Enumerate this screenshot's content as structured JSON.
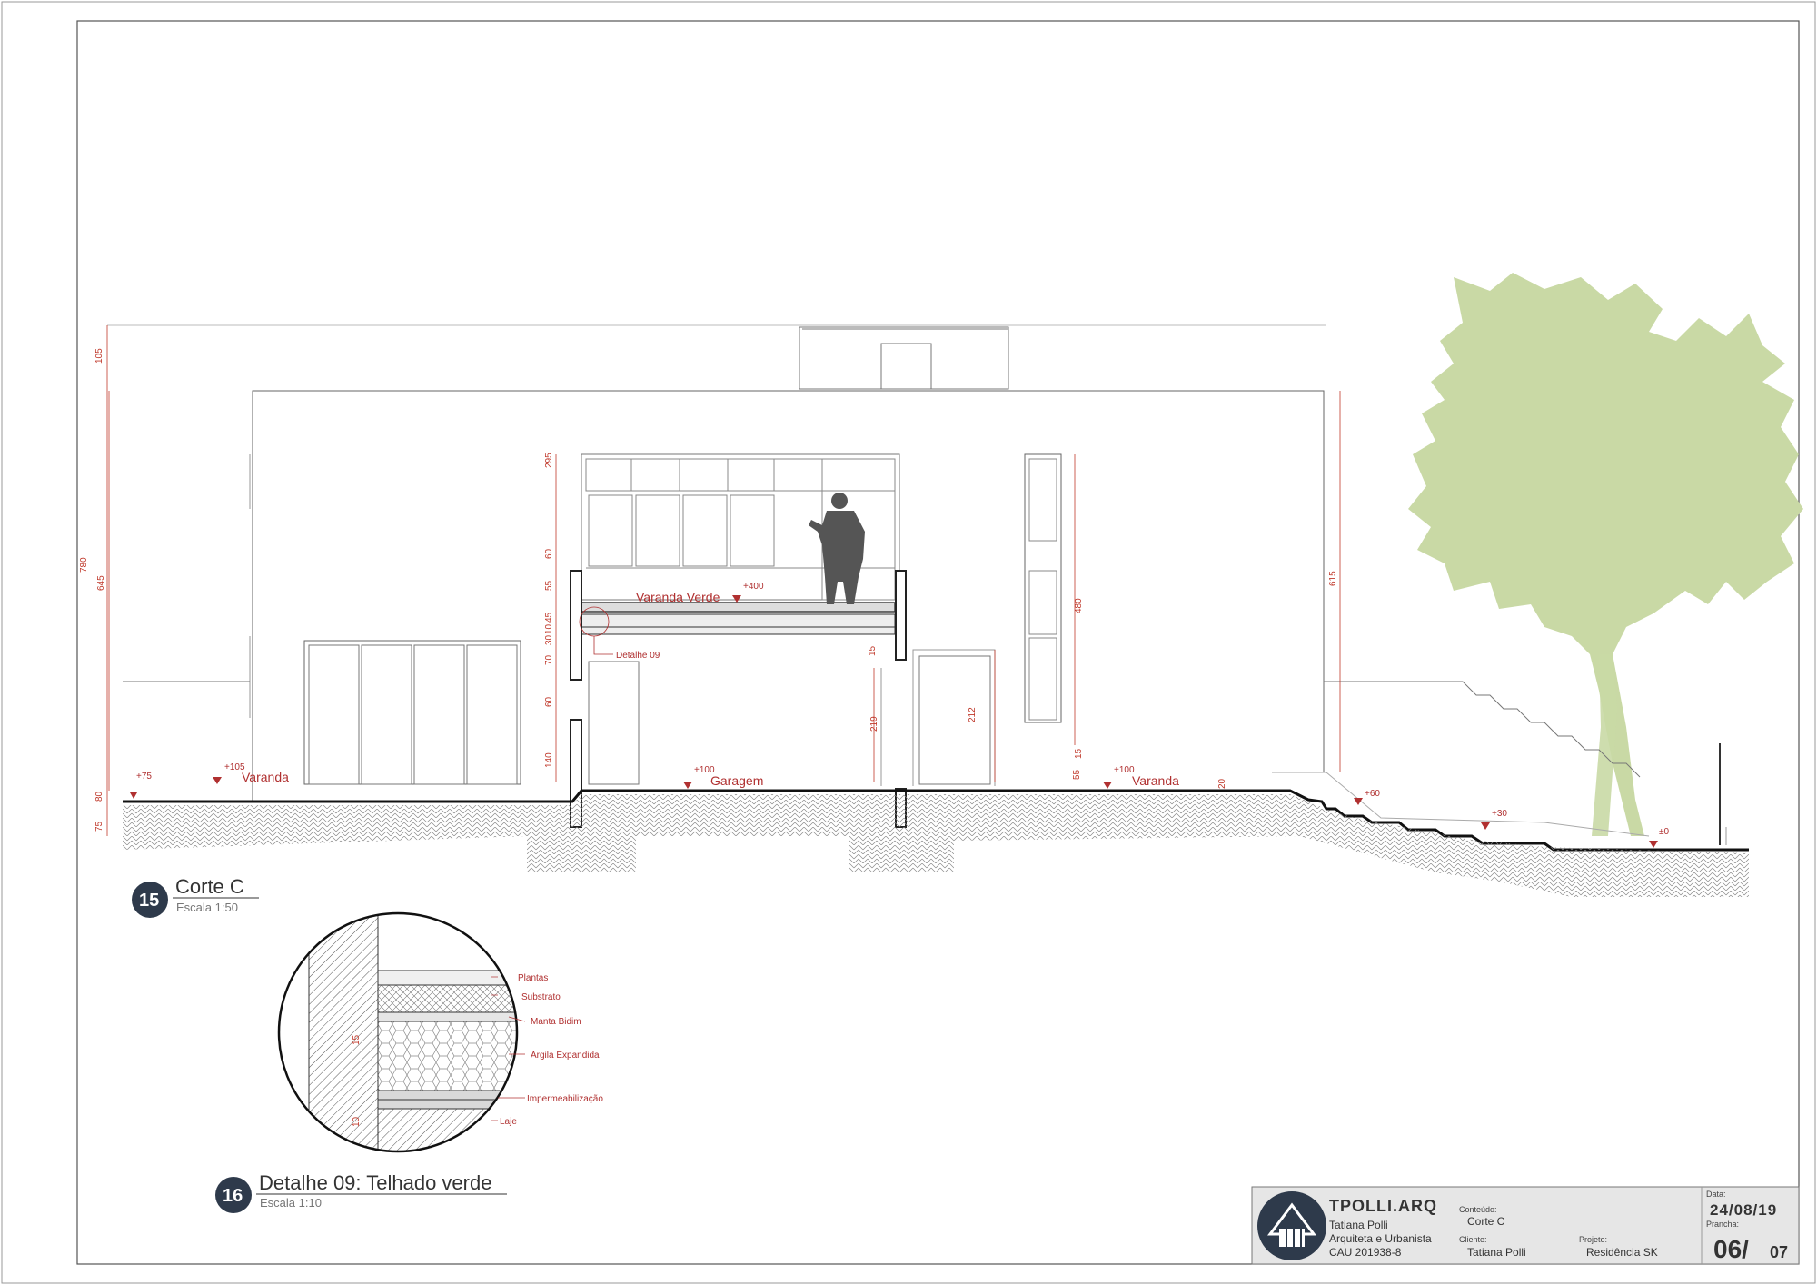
{
  "section": {
    "number": "15",
    "title": "Corte C",
    "scale": "Escala 1:50",
    "rooms": [
      "Varanda",
      "Varanda Verde",
      "Garagem",
      "Varanda"
    ],
    "detail_callout": "Detalhe 09",
    "levels": [
      "+75",
      "+105",
      "+400",
      "+100",
      "+100",
      "+60",
      "+30",
      "±0",
      "±0"
    ],
    "dims_left": [
      "105",
      "780",
      "645",
      "80",
      "75"
    ],
    "dims_mid": [
      "295",
      "60",
      "55",
      "45",
      "10",
      "30",
      "70",
      "60",
      "140"
    ],
    "dims_right": [
      "615",
      "480",
      "15",
      "55",
      "20"
    ],
    "dims_inner": [
      "219",
      "212",
      "15",
      "20"
    ]
  },
  "detail": {
    "number": "16",
    "title": "Detalhe 09: Telhado verde",
    "scale": "Escala 1:10",
    "layers": [
      "Plantas",
      "Substrato",
      "Manta Bidim",
      "Argila Expandida",
      "Impermeabilização",
      "Laje"
    ],
    "dims": [
      "15",
      "10"
    ]
  },
  "title_block": {
    "brand": "TPOLLI.ARQ",
    "author": "Tatiana Polli",
    "role": "Arquiteta e Urbanista",
    "registration": "CAU 201938-8",
    "content_label": "Conteúdo:",
    "content_value": "Corte C",
    "client_label": "Cliente:",
    "client_value": "Tatiana Polli",
    "project_label": "Projeto:",
    "project_value": "Residência SK",
    "date_label": "Data:",
    "date_value": "24/08/19",
    "sheet_label": "Prancha:",
    "sheet_value": "06/",
    "sheet_total": "07"
  },
  "colors": {
    "annotation_red": "#b03030",
    "tree_green": "#c9d9a5",
    "badge_navy": "#2e3a4b"
  }
}
